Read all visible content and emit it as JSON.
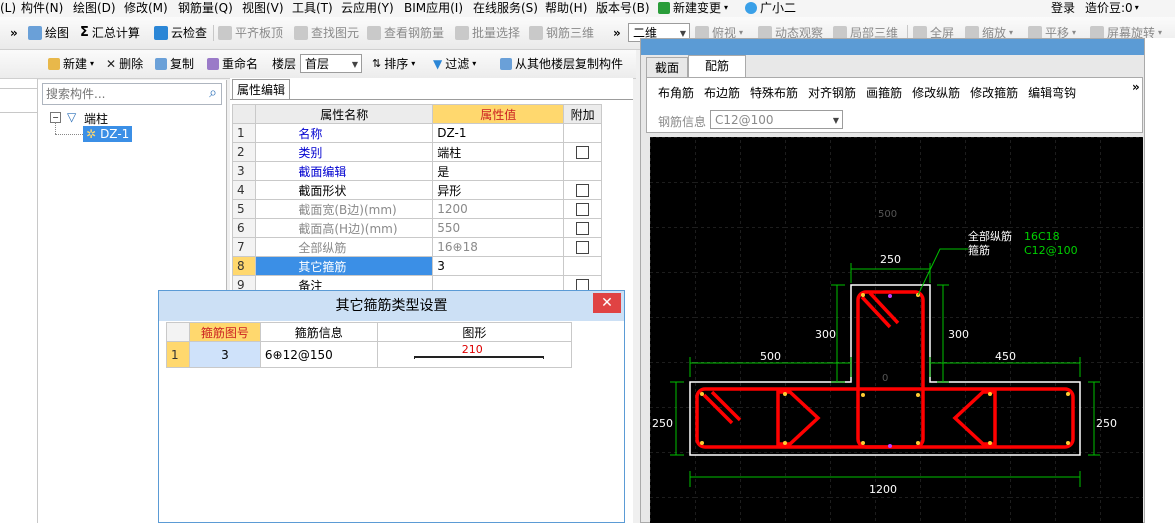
{
  "menu": [
    "(L)",
    "构件(N)",
    "绘图(D)",
    "修改(M)",
    "钢筋量(Q)",
    "视图(V)",
    "工具(T)",
    "云应用(Y)",
    "BIM应用(I)",
    "在线服务(S)",
    "帮助(H)",
    "版本号(B)",
    "新建变更",
    "广小二",
    "登录",
    "造价豆:0"
  ],
  "toolbar1": {
    "draw": "绘图",
    "sum": "汇总计算",
    "cloud_check": "云检查",
    "flat_top": "平齐板顶",
    "find": "查找图元",
    "view_rebar": "查看钢筋量",
    "batch_select": "批量选择",
    "rebar_3d": "钢筋三维",
    "view_mode": "二维",
    "top_view": "俯视",
    "dynamic": "动态观察",
    "local_3d": "局部三维",
    "fullscreen": "全屏",
    "zoom": "缩放",
    "pan": "平移",
    "rotate": "屏幕旋转"
  },
  "toolbar2": {
    "new": "新建",
    "delete": "删除",
    "copy": "复制",
    "rename": "重命名",
    "floor_label": "楼层",
    "floor_value": "首层",
    "sort": "排序",
    "filter": "过滤",
    "copy_from": "从其他楼层复制构件"
  },
  "tree": {
    "search_placeholder": "搜索构件...",
    "root": "端柱",
    "child": "DZ-1"
  },
  "props": {
    "tab": "属性编辑",
    "headers": [
      "属性名称",
      "属性值",
      "附加"
    ],
    "rows": [
      {
        "n": "1",
        "name": "名称",
        "value": "DZ-1",
        "style": "blue",
        "chk": false
      },
      {
        "n": "2",
        "name": "类别",
        "value": "端柱",
        "style": "blue",
        "chk": true
      },
      {
        "n": "3",
        "name": "截面编辑",
        "value": "是",
        "style": "blue",
        "chk": false
      },
      {
        "n": "4",
        "name": "截面形状",
        "value": "异形",
        "style": "",
        "chk": true
      },
      {
        "n": "5",
        "name": "截面宽(B边)(mm)",
        "value": "1200",
        "style": "gray",
        "chk": true
      },
      {
        "n": "6",
        "name": "截面高(H边)(mm)",
        "value": "550",
        "style": "gray",
        "chk": true
      },
      {
        "n": "7",
        "name": "全部纵筋",
        "value": "16⊕18",
        "style": "gray",
        "chk": true
      },
      {
        "n": "8",
        "name": "其它箍筋",
        "value": "3",
        "style": "sel",
        "chk": false
      },
      {
        "n": "9",
        "name": "备注",
        "value": "",
        "style": "",
        "chk": true
      }
    ]
  },
  "dialog": {
    "title": "其它箍筋类型设置",
    "close": "✕",
    "headers": [
      "箍筋图号",
      "箍筋信息",
      "图形"
    ],
    "rows": [
      {
        "n": "1",
        "code": "3",
        "info": "6⊕12@150",
        "shape": "210"
      }
    ]
  },
  "right": {
    "tabs": [
      "截面",
      "配筋"
    ],
    "tools": [
      "布角筋",
      "布边筋",
      "特殊布筋",
      "对齐钢筋",
      "画箍筋",
      "修改纵筋",
      "修改箍筋",
      "编辑弯钩"
    ],
    "info_label": "钢筋信息",
    "info_value": "C12@100",
    "dims": {
      "d250_top": "250",
      "d300_left": "300",
      "d300_right": "300",
      "d500": "500",
      "d450": "450",
      "d250_left": "250",
      "d250_right": "250",
      "d1200": "1200",
      "grid500": "500",
      "grid0": "0"
    },
    "label_all": "全部纵筋",
    "label_stirrup": "箍筋",
    "label_all_val": "16C18",
    "label_stirrup_val": "C12@100"
  },
  "colors": {
    "accent": "#3b8fe6",
    "highlight": "#ffd86e",
    "rebar": "#ff0000",
    "dim": "#00c000",
    "outline": "#ffffff"
  }
}
